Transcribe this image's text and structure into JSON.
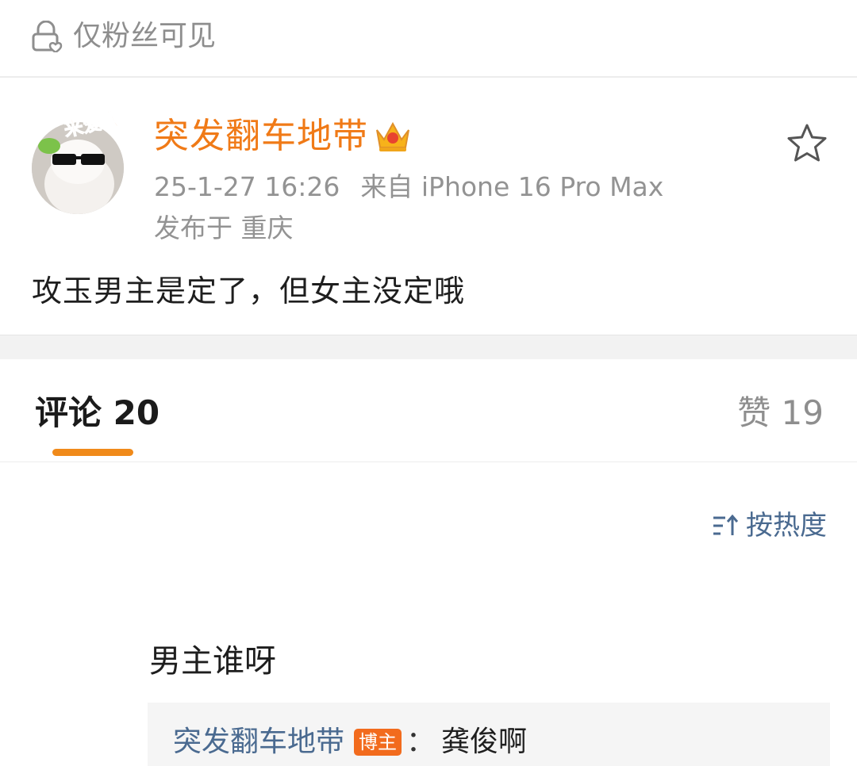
{
  "visibility": {
    "text": "仅粉丝可见",
    "icon": "lock-heart-icon"
  },
  "post": {
    "author": "突发翻车地带",
    "author_color": "#f07a17",
    "badge_icon": "crown-icon",
    "avatar_badge_text": "来爱我",
    "time": "25-1-27 16:26",
    "source": "来自 iPhone 16 Pro Max",
    "location": "发布于 重庆",
    "content": "攻玉男主是定了，但女主没定哦",
    "favorite_icon": "star-icon"
  },
  "tabs": {
    "comments_label": "评论 20",
    "likes_label": "赞 19",
    "accent_color": "#f08a1a"
  },
  "sort": {
    "label": "按热度",
    "icon": "sort-icon"
  },
  "comment": {
    "text": "男主谁呀",
    "reply": {
      "author": "突发翻车地带",
      "badge": "博主",
      "colon": "：",
      "text": "龚俊啊"
    }
  }
}
